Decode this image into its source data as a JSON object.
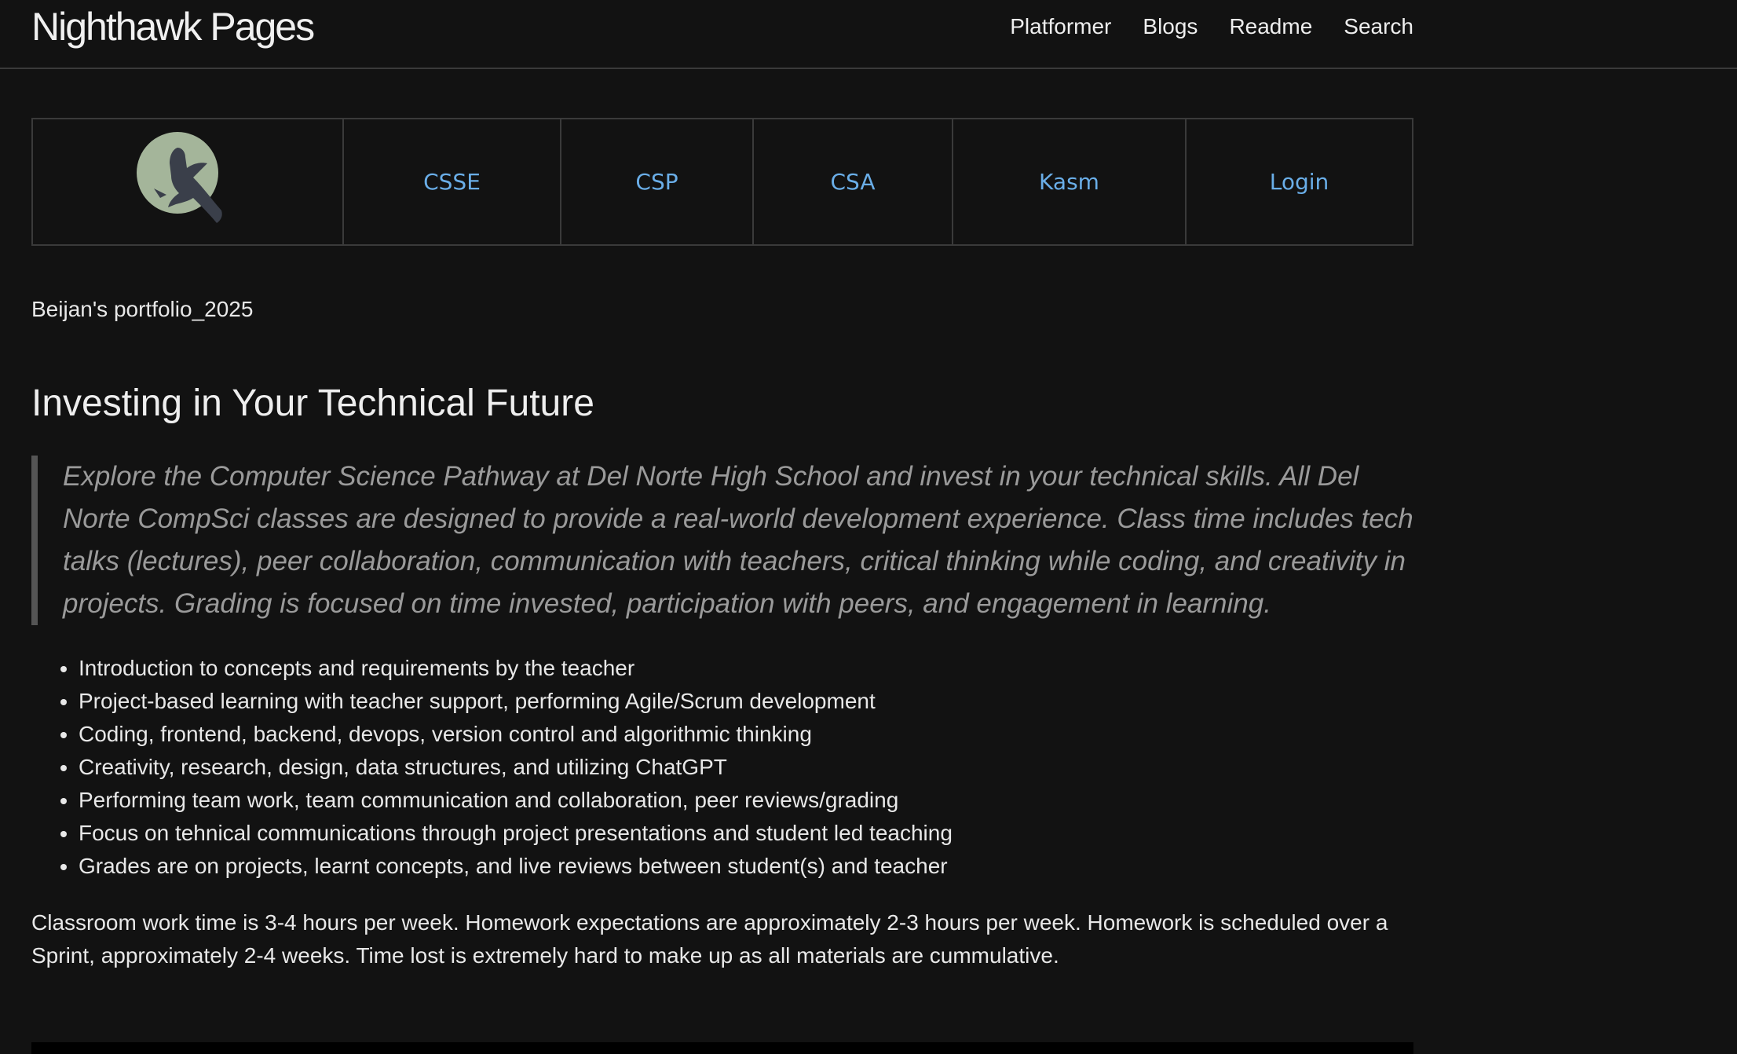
{
  "header": {
    "site_title": "Nighthawk Pages",
    "nav": [
      {
        "label": "Platformer"
      },
      {
        "label": "Blogs"
      },
      {
        "label": "Readme"
      },
      {
        "label": "Search"
      }
    ]
  },
  "course_nav": {
    "logo_icon": "nighthawk-bird-icon",
    "links": [
      {
        "label": "CSSE"
      },
      {
        "label": "CSP"
      },
      {
        "label": "CSA"
      },
      {
        "label": "Kasm"
      },
      {
        "label": "Login"
      }
    ]
  },
  "content": {
    "portfolio_line": "Beijan's portfolio_2025",
    "heading": "Investing in Your Technical Future",
    "quote": "Explore the Computer Science Pathway at Del Norte High School and invest in your technical skills. All Del Norte CompSci classes are designed to provide a real-world development experience. Class time includes tech talks (lectures), peer collaboration, communication with teachers, critical thinking while coding, and creativity in projects. Grading is focused on time invested, participation with peers, and engagement in learning.",
    "features": [
      "Introduction to concepts and requirements by the teacher",
      "Project-based learning with teacher support, performing Agile/Scrum development",
      "Coding, frontend, backend, devops, version control and algorithmic thinking",
      "Creativity, research, design, data structures, and utilizing ChatGPT",
      "Performing team work, team communication and collaboration, peer reviews/grading",
      "Focus on tehnical communications through project presentations and student led teaching",
      "Grades are on projects, learnt concepts, and live reviews between student(s) and teacher"
    ],
    "classroom_note": "Classroom work time is 3-4 hours per week. Homework expectations are approximately 2-3 hours per week. Homework is scheduled over a Sprint, approximately 2-4 weeks. Time lost is extremely hard to make up as all materials are cummulative."
  },
  "colors": {
    "background": "#121212",
    "link": "#6aaee8",
    "logo_circle": "#a4b59a",
    "logo_bird": "#3a3f4a"
  }
}
